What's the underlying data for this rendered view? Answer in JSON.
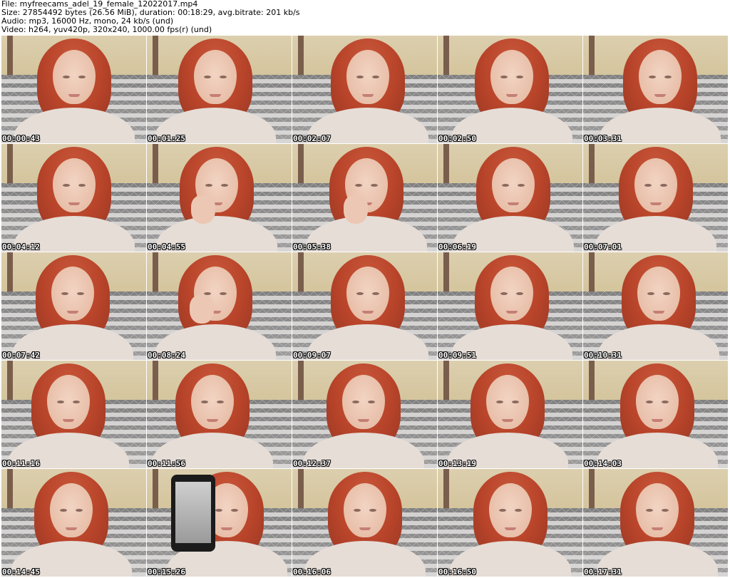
{
  "header": {
    "file": "File: myfreecams_adel_19_female_12022017.mp4",
    "size": "Size: 27854492 bytes (26.56 MiB), duration: 00:18:29, avg.bitrate: 201 kb/s",
    "audio": "Audio: mp3, 16000 Hz, mono, 24 kb/s (und)",
    "video": "Video: h264, yuv420p, 320x240, 1000.00 fps(r) (und)"
  },
  "thumbnails": [
    {
      "timestamp": "00:00:43"
    },
    {
      "timestamp": "00:01:25"
    },
    {
      "timestamp": "00:02:07"
    },
    {
      "timestamp": "00:02:50"
    },
    {
      "timestamp": "00:03:31"
    },
    {
      "timestamp": "00:04:12"
    },
    {
      "timestamp": "00:04:55"
    },
    {
      "timestamp": "00:05:38"
    },
    {
      "timestamp": "00:06:19"
    },
    {
      "timestamp": "00:07:01"
    },
    {
      "timestamp": "00:07:42"
    },
    {
      "timestamp": "00:08:24"
    },
    {
      "timestamp": "00:09:07"
    },
    {
      "timestamp": "00:09:51"
    },
    {
      "timestamp": "00:10:31"
    },
    {
      "timestamp": "00:11:16"
    },
    {
      "timestamp": "00:11:56"
    },
    {
      "timestamp": "00:12:37"
    },
    {
      "timestamp": "00:13:19"
    },
    {
      "timestamp": "00:14:03"
    },
    {
      "timestamp": "00:14:45"
    },
    {
      "timestamp": "00:15:26"
    },
    {
      "timestamp": "00:16:06"
    },
    {
      "timestamp": "00:16:50"
    },
    {
      "timestamp": "00:17:31"
    }
  ],
  "colors": {
    "timestamp_text": "#ffffff",
    "timestamp_outline": "#000000",
    "hair": "#b8442a",
    "wall": "#d6c7a0",
    "blanket_dark": "#4a4a4c"
  }
}
